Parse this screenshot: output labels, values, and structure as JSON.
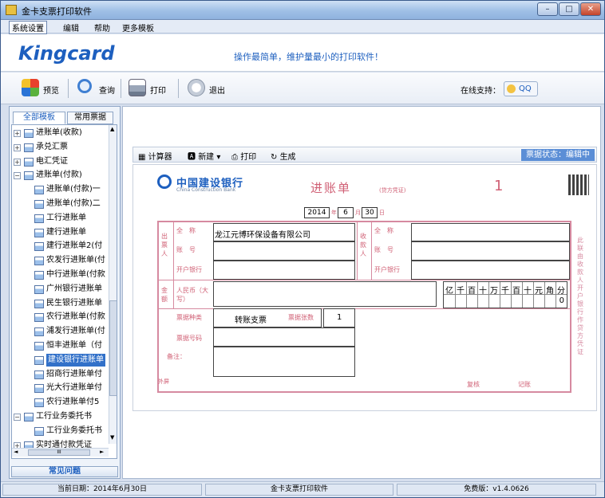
{
  "window": {
    "title": "金卡支票打印软件",
    "controls": [
      "–",
      "□",
      "✕"
    ]
  },
  "menu": {
    "items": [
      "系统设置",
      "编辑",
      "帮助",
      "更多模板"
    ]
  },
  "banner": {
    "brand": "Kingcard",
    "slogan": "操作最简单，维护量最小的打印软件！"
  },
  "toolbar": {
    "preview": "预览",
    "query": "查询",
    "print": "打印",
    "exit": "退出",
    "online_label": "在线支持：",
    "qq": "QQ"
  },
  "sidebar": {
    "tabs": [
      "全部模板",
      "常用票据"
    ],
    "items": [
      {
        "label": "进账单(收款)",
        "level": 0,
        "exp": "+"
      },
      {
        "label": "承兑汇票",
        "level": 0,
        "exp": "+"
      },
      {
        "label": "电汇凭证",
        "level": 0,
        "exp": "+"
      },
      {
        "label": "进账单(付款)",
        "level": 0,
        "exp": "−"
      },
      {
        "label": "进账单(付款)一",
        "level": 1
      },
      {
        "label": "进账单(付款)二",
        "level": 1
      },
      {
        "label": "工行进账单",
        "level": 1
      },
      {
        "label": "建行进账单",
        "level": 1
      },
      {
        "label": "建行进账单2(付",
        "level": 1
      },
      {
        "label": "农发行进账单(付",
        "level": 1
      },
      {
        "label": "中行进账单(付款",
        "level": 1
      },
      {
        "label": "广州银行进账单",
        "level": 1
      },
      {
        "label": "民生银行进账单",
        "level": 1
      },
      {
        "label": "农行进账单(付款",
        "level": 1
      },
      {
        "label": "浦发行进账单(付",
        "level": 1
      },
      {
        "label": "恒丰进账单（付",
        "level": 1
      },
      {
        "label": "建设银行进账单",
        "level": 1,
        "selected": true
      },
      {
        "label": "招商行进账单付",
        "level": 1
      },
      {
        "label": "光大行进账单付",
        "level": 1
      },
      {
        "label": "农行进账单付5",
        "level": 1
      },
      {
        "label": "工行业务委托书",
        "level": 0,
        "exp": "−"
      },
      {
        "label": "工行业务委托书",
        "level": 1
      },
      {
        "label": "实时通付款凭证",
        "level": 0,
        "exp": "+"
      }
    ],
    "hscroll_label": "III",
    "faq": "常见问题"
  },
  "editor": {
    "calc": "计算器",
    "new": "新建",
    "print": "打印",
    "generate": "生成",
    "status": "票据状态：编辑中"
  },
  "document": {
    "bank_name": "中国建设银行",
    "bank_en": "China Construction Bank",
    "title": "进账单",
    "subtitle": "(贷方凭证)",
    "number": "1",
    "date": {
      "year": "2014",
      "month": "6",
      "day": "30",
      "u_year": "年",
      "u_month": "月",
      "u_day": "日"
    },
    "payer_label": "出票人",
    "payee_label": "收款人",
    "full_name_label": "全　称",
    "account_label": "账　号",
    "bank_label": "开户银行",
    "payer_name": "龙江元博环保设备有限公司",
    "amount_label": "金额",
    "rmb_label": "人民币（大写）",
    "digits": [
      "亿",
      "千",
      "百",
      "十",
      "万",
      "千",
      "百",
      "十",
      "元",
      "角",
      "分"
    ],
    "amount_value": "0",
    "type_label": "票据种类",
    "type_value": "转账支票",
    "count_label": "票据张数",
    "count_value": "1",
    "docno_label": "票据号码",
    "note_label": "备注：",
    "review_label": "复核",
    "keep_label": "记账",
    "side_note": "此联由收款人开户银行作贷方凭证",
    "left_note": "外屏"
  },
  "statusbar": {
    "date": "当前日期：2014年6月30日",
    "app": "金卡支票打印软件",
    "version": "免费版：v1.4.0626"
  }
}
